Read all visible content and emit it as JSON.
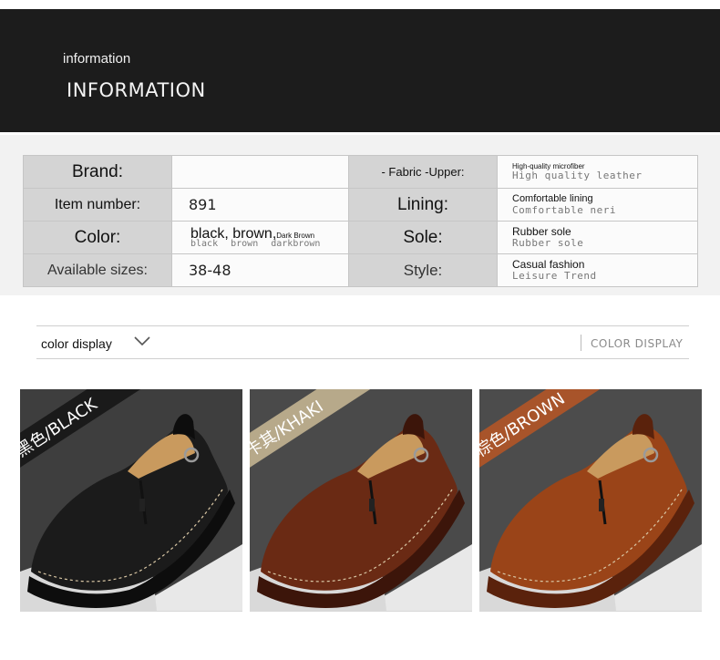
{
  "header": {
    "small_title": "information",
    "big_title": "INFORMATION"
  },
  "info_table": {
    "brand_label": "Brand:",
    "brand_value": "",
    "fabric_label": "- Fabric -Upper:",
    "fabric_value": "High-quality microfiber",
    "fabric_sub": "High quality leather",
    "item_label": "Item number:",
    "item_value": "891",
    "lining_label": "Lining:",
    "lining_value": "Comfortable lining",
    "lining_sub": "Comfortable neri",
    "color_label": "Color:",
    "color_value": "black, brown,",
    "color_value_small": "Dark Brown",
    "color_sub": "black brown darkbrown",
    "sole_label": "Sole:",
    "sole_value": "Rubber sole",
    "sole_sub": "Rubber sole",
    "sizes_label": "Available sizes:",
    "sizes_value": "38-48",
    "style_label": "Style:",
    "style_value": "Casual fashion",
    "style_sub": "Leisure Trend"
  },
  "color_display": {
    "label": "color display",
    "right_label": "COLOR DISPLAY",
    "chevron_icon": "chevron-down-icon"
  },
  "products": [
    {
      "tag": "黑色/BLACK",
      "tag_bg": "#1a1a1a",
      "shoe_color": "#1b1b1b",
      "shoe_dark": "#0d0d0d",
      "bg": "#3e3e3e"
    },
    {
      "tag": "卡其/KHAKI",
      "tag_bg": "#b7a98a",
      "shoe_color": "#6a2a14",
      "shoe_dark": "#3c150a",
      "bg": "#4a4a4a"
    },
    {
      "tag": "棕色/BROWN",
      "tag_bg": "#a8542a",
      "shoe_color": "#9a4418",
      "shoe_dark": "#5a220c",
      "bg": "#4c4c4c"
    }
  ]
}
